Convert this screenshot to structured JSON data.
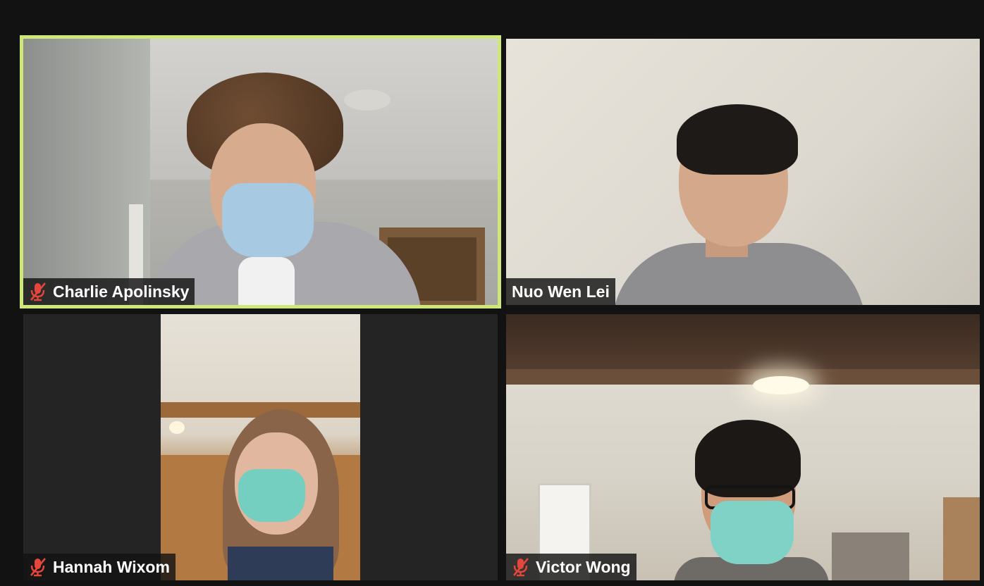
{
  "app": {
    "view": "gallery",
    "active_speaker_border_color": "#cfe67a",
    "background_color": "#121212"
  },
  "participants": [
    {
      "name": "Charlie Apolinsky",
      "muted": true,
      "active_speaker": true
    },
    {
      "name": "Nuo Wen Lei",
      "muted": false,
      "active_speaker": false
    },
    {
      "name": "Hannah Wixom",
      "muted": true,
      "active_speaker": false
    },
    {
      "name": "Victor Wong",
      "muted": true,
      "active_speaker": false
    }
  ],
  "icons": {
    "muted_mic": "mic-off-icon",
    "muted_mic_color": "#e5453a"
  }
}
